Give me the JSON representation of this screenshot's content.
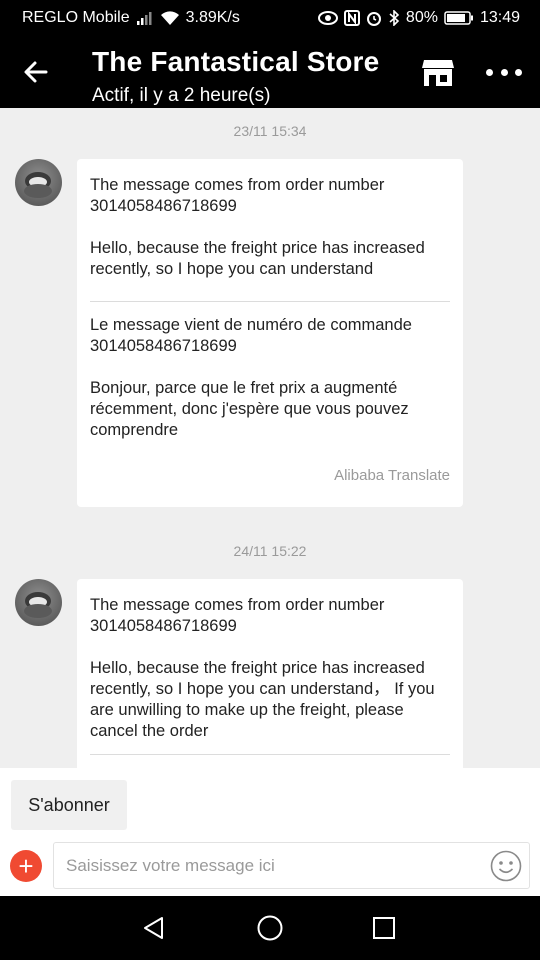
{
  "status_bar": {
    "carrier": "REGLO Mobile",
    "speed": "3.89K/s",
    "battery": "80%",
    "time": "13:49"
  },
  "header": {
    "title": "The Fantastical Store",
    "subtitle": "Actif, il y a 2 heure(s)"
  },
  "messages": [
    {
      "timestamp": "23/11 15:34",
      "original": [
        "The message comes from order number 3014058486718699",
        "Hello, because the freight price has increased recently, so I hope you can understand"
      ],
      "translation": [
        "Le message vient de numéro de commande 3014058486718699",
        "Bonjour, parce que le fret prix a augmenté récemment, donc j'espère que vous pouvez comprendre"
      ],
      "translation_credit": "Alibaba Translate"
    },
    {
      "timestamp": "24/11 15:22",
      "original": [
        "The message comes from order number 3014058486718699",
        "Hello, because the freight price has increased recently, so I hope you can understand，  If you are unwilling to make up the freight, please cancel the order"
      ]
    }
  ],
  "bottom": {
    "subscribe_label": "S'abonner",
    "plus_label": "+",
    "input_placeholder": "Saisissez votre message ici",
    "input_value": ""
  },
  "icons": {
    "back": "arrow-left-icon",
    "store": "store-icon",
    "more": "more-dots-icon",
    "add": "plus-icon",
    "emoji": "smiley-icon",
    "nav_back": "triangle-back-icon",
    "nav_home": "circle-home-icon",
    "nav_recent": "square-recent-icon"
  },
  "colors": {
    "header_bg": "#000000",
    "chat_bg": "#efefef",
    "accent": "#f04a32"
  }
}
